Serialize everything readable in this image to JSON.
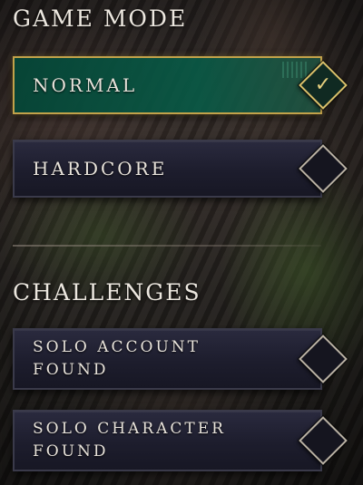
{
  "game_mode": {
    "title": "GAME MODE",
    "options": [
      {
        "label": "NORMAL",
        "selected": true
      },
      {
        "label": "HARDCORE",
        "selected": false
      }
    ]
  },
  "challenges": {
    "title": "CHALLENGES",
    "options": [
      {
        "label_line1": "SOLO ACCOUNT",
        "label_line2": "FOUND",
        "selected": false
      },
      {
        "label_line1": "SOLO CHARACTER",
        "label_line2": "FOUND",
        "selected": false
      }
    ]
  },
  "icons": {
    "selected": "checkmark-icon",
    "unselected": "empty-diamond-icon"
  },
  "colors": {
    "selected_accent": "#c2a24a",
    "selected_fill": "#085a46",
    "option_fill": "#1d1d2d",
    "text": "#e8e3db"
  }
}
